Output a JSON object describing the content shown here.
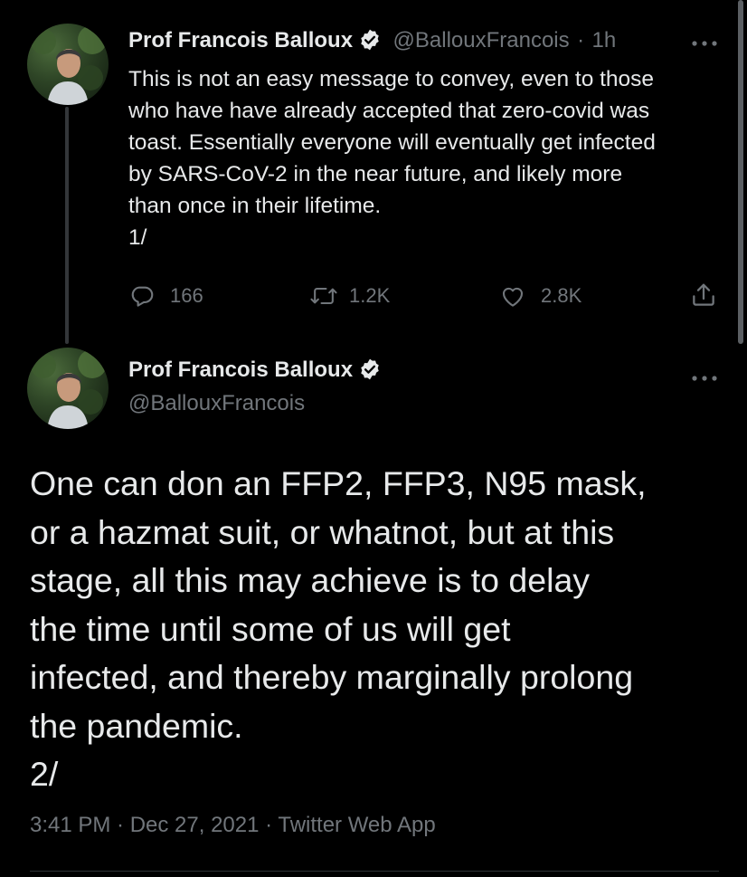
{
  "tweet1": {
    "author_name": "Prof Francois Balloux",
    "author_handle": "@BallouxFrancois",
    "time_sep": "·",
    "time_ago": "1h",
    "body": "This is not an easy message to convey, even to those\nwho have have already accepted that zero-covid was\ntoast. Essentially everyone will eventually get infected\nby SARS-CoV-2 in the near future, and likely more\nthan once in their lifetime.\n1/",
    "replies": "166",
    "retweets": "1.2K",
    "likes": "2.8K",
    "icons": [
      "reply-icon",
      "retweet-icon",
      "like-icon",
      "share-icon",
      "more-icon",
      "verified-badge-icon"
    ]
  },
  "tweet2": {
    "author_name": "Prof Francois Balloux",
    "author_handle": "@BallouxFrancois",
    "body": "One can don an FFP2, FFP3, N95 mask,\nor a hazmat suit, or whatnot, but at this\nstage, all this may achieve is to delay\nthe time until some of us will get\ninfected, and thereby marginally prolong\nthe pandemic.\n2/",
    "timestamp": "3:41 PM · Dec 27, 2021 · Twitter Web App"
  },
  "colors": {
    "background": "#000000",
    "text_primary": "#e7e9ea",
    "text_secondary": "#71767b",
    "verified_badge": "#e7e9ea",
    "thread_line": "#333639"
  }
}
